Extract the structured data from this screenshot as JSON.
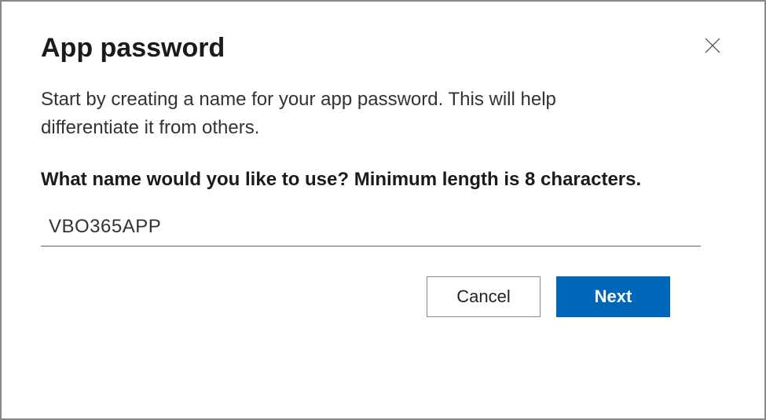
{
  "dialog": {
    "title": "App password",
    "description": "Start by creating a name for your app password. This will help differentiate it from others.",
    "prompt_label": "What name would you like to use? Minimum length is 8 characters.",
    "name_input": {
      "value": "VBO365APP"
    },
    "buttons": {
      "cancel_label": "Cancel",
      "next_label": "Next"
    }
  }
}
